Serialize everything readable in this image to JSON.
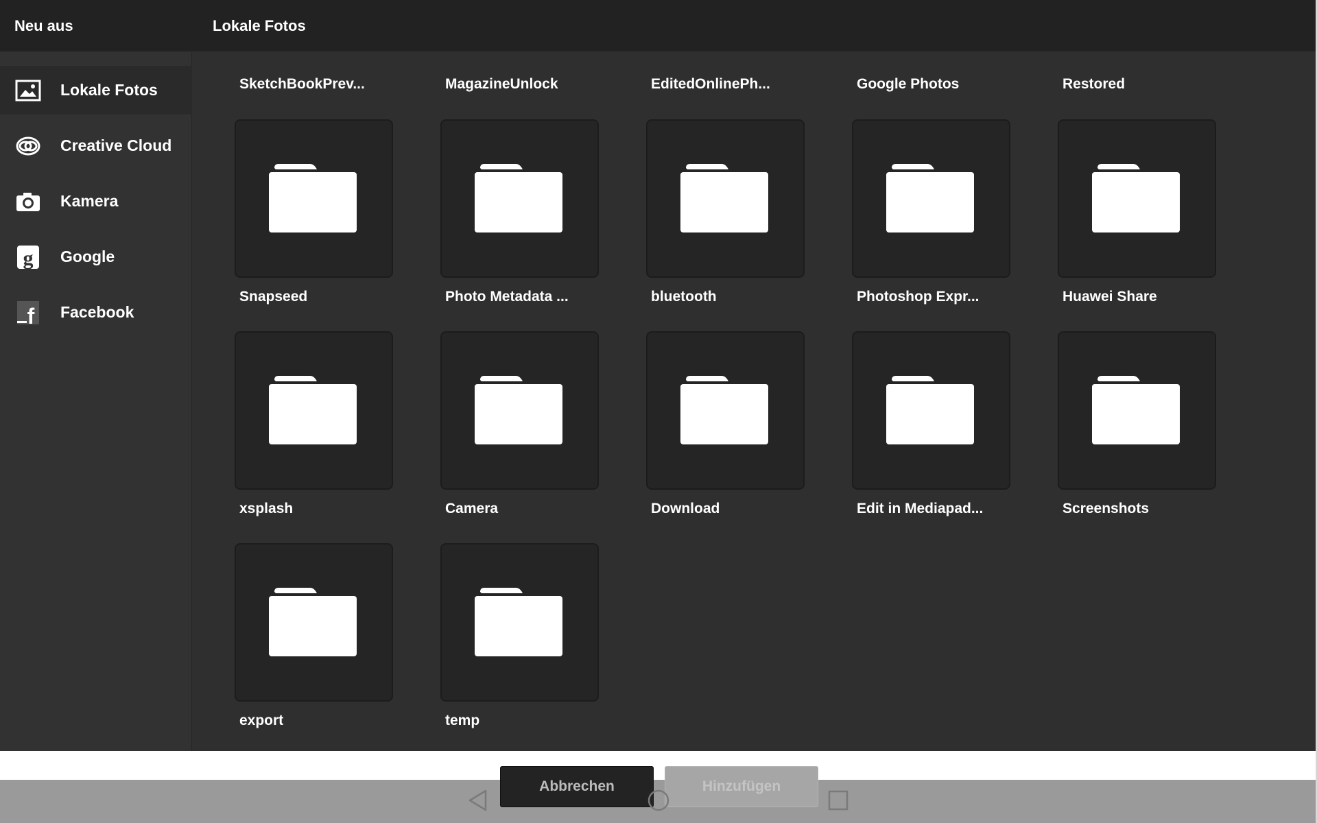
{
  "header": {
    "left_title": "Neu aus",
    "right_title": "Lokale Fotos"
  },
  "sidebar": {
    "items": [
      {
        "label": "Lokale Fotos",
        "icon": "image-icon",
        "active": true
      },
      {
        "label": "Creative Cloud",
        "icon": "creative-cloud-icon",
        "active": false
      },
      {
        "label": "Kamera",
        "icon": "camera-icon",
        "active": false
      },
      {
        "label": "Google",
        "icon": "google-icon",
        "active": false
      },
      {
        "label": "Facebook",
        "icon": "facebook-icon",
        "active": false
      }
    ]
  },
  "grid": {
    "top_labels": [
      "SketchBookPrev...",
      "MagazineUnlock",
      "EditedOnlinePh...",
      "Google Photos",
      "Restored"
    ],
    "folders": [
      "Snapseed",
      "Photo Metadata ...",
      "bluetooth",
      "Photoshop Expr...",
      "Huawei Share",
      "xsplash",
      "Camera",
      "Download",
      "Edit in Mediapad...",
      "Screenshots",
      "export",
      "temp"
    ]
  },
  "actions": {
    "cancel_label": "Abbrechen",
    "add_label": "Hinzufügen"
  },
  "navbar": {
    "icons": [
      "back-icon",
      "home-icon",
      "recents-icon"
    ]
  },
  "colors": {
    "background": "#2f2f2f",
    "header": "#222222",
    "tile": "#252525",
    "text": "#ffffff"
  }
}
